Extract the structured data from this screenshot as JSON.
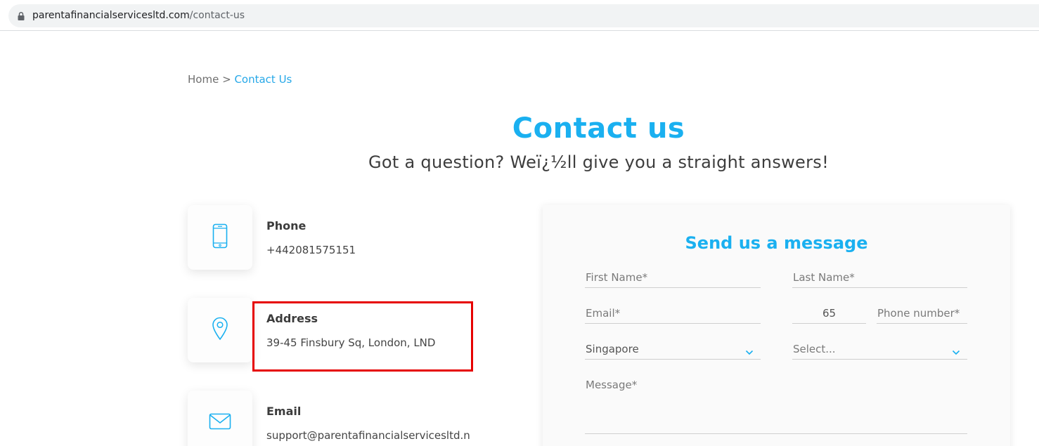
{
  "browser": {
    "url_domain": "parentafinancialservicesltd.com",
    "url_path": "/contact-us"
  },
  "breadcrumb": {
    "home": "Home",
    "separator": ">",
    "current": "Contact Us"
  },
  "page": {
    "title": "Contact us",
    "subtitle": "Got a question? Weï¿½ll give you a straight answers!"
  },
  "contact_info": {
    "phone": {
      "label": "Phone",
      "value": "+442081575151",
      "icon": "phone-icon"
    },
    "address": {
      "label": "Address",
      "value": "39-45 Finsbury Sq, London, LND",
      "icon": "map-pin-icon"
    },
    "email": {
      "label": "Email",
      "value": "support@parentafinancialservicesltd.net",
      "icon": "envelope-icon"
    }
  },
  "form": {
    "title": "Send us a message",
    "first_name_placeholder": "First Name*",
    "last_name_placeholder": "Last Name*",
    "email_placeholder": "Email*",
    "country_code": "65",
    "phone_placeholder": "Phone number*",
    "country_selected": "Singapore",
    "select_placeholder": "Select...",
    "message_placeholder": "Message*"
  },
  "colors": {
    "accent": "#1ab0f0",
    "highlight": "#e60000"
  }
}
